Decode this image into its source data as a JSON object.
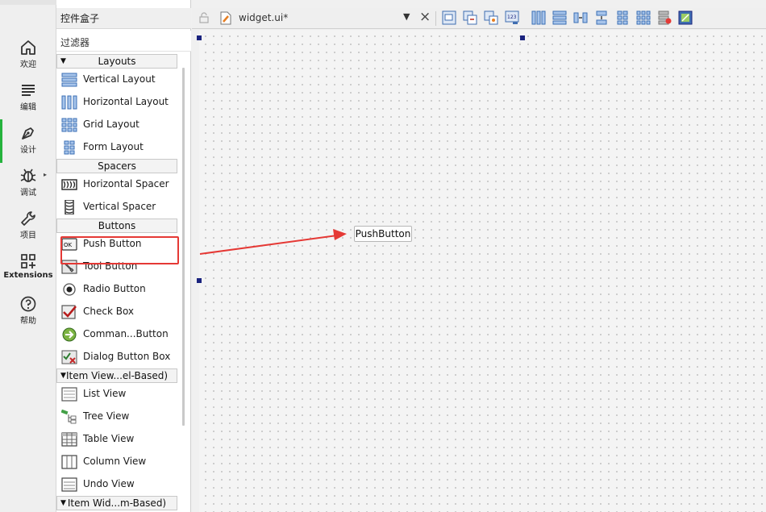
{
  "modes": [
    {
      "label": "欢迎",
      "icon": "home-icon"
    },
    {
      "label": "编辑",
      "icon": "edit-lines-icon"
    },
    {
      "label": "设计",
      "icon": "pen-icon",
      "active": true
    },
    {
      "label": "调试",
      "icon": "bug-icon"
    },
    {
      "label": "项目",
      "icon": "wrench-icon"
    },
    {
      "label": "Extensions",
      "icon": "extensions-icon"
    },
    {
      "label": "帮助",
      "icon": "help-icon"
    }
  ],
  "widget_box": {
    "title": "控件盒子",
    "filter_placeholder": "过滤器",
    "categories": [
      {
        "name": "Layouts",
        "items": [
          {
            "label": "Vertical Layout",
            "icon": "vertical-layout-icon"
          },
          {
            "label": "Horizontal Layout",
            "icon": "horizontal-layout-icon"
          },
          {
            "label": "Grid Layout",
            "icon": "grid-layout-icon"
          },
          {
            "label": "Form Layout",
            "icon": "form-layout-icon"
          }
        ]
      },
      {
        "name": "Spacers",
        "items": [
          {
            "label": "Horizontal Spacer",
            "icon": "horizontal-spacer-icon"
          },
          {
            "label": "Vertical Spacer",
            "icon": "vertical-spacer-icon"
          }
        ]
      },
      {
        "name": "Buttons",
        "items": [
          {
            "label": "Push Button",
            "icon": "push-button-icon"
          },
          {
            "label": "Tool Button",
            "icon": "tool-button-icon"
          },
          {
            "label": "Radio Button",
            "icon": "radio-button-icon"
          },
          {
            "label": "Check Box",
            "icon": "check-box-icon"
          },
          {
            "label": "Comman...Button",
            "icon": "command-link-icon"
          },
          {
            "label": "Dialog Button Box",
            "icon": "dialog-button-box-icon"
          }
        ]
      },
      {
        "name": "Item View...el-Based)",
        "items": [
          {
            "label": "List View",
            "icon": "list-view-icon"
          },
          {
            "label": "Tree View",
            "icon": "tree-view-icon"
          },
          {
            "label": "Table View",
            "icon": "table-view-icon"
          },
          {
            "label": "Column View",
            "icon": "column-view-icon"
          },
          {
            "label": "Undo View",
            "icon": "undo-view-icon"
          }
        ]
      },
      {
        "name": "Item Wid...m-Based)",
        "items": []
      }
    ]
  },
  "editor": {
    "file_name": "widget.ui*"
  },
  "toolbar_icons": [
    "edit-widgets-icon",
    "edit-signals-icon",
    "edit-buddies-icon",
    "edit-tab-order-icon",
    "lay-out-horizontally-icon",
    "lay-out-vertically-icon",
    "lay-out-horizontal-splitter-icon",
    "lay-out-vertical-splitter-icon",
    "lay-out-form-icon",
    "lay-out-grid-icon",
    "break-layout-icon",
    "adjust-size-icon"
  ],
  "form": {
    "push_button_text": "PushButton"
  },
  "colors": {
    "active_mode_accent": "#25b33d",
    "annotation_red": "#e53935",
    "selection_handle": "#1a237e"
  }
}
